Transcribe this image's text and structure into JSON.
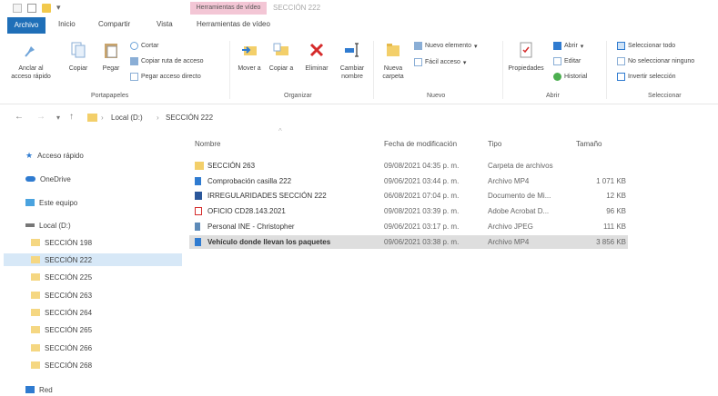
{
  "titlebar": {
    "context_tab": "Herramientas de vídeo",
    "window_title": "SECCIÓN 222"
  },
  "tabs": [
    {
      "label": "Archivo"
    },
    {
      "label": "Inicio"
    },
    {
      "label": "Compartir"
    },
    {
      "label": "Vista"
    },
    {
      "label": "Herramientas de vídeo"
    }
  ],
  "ribbon": {
    "anclar": "Anclar al acceso rápido",
    "copiar": "Copiar",
    "pegar": "Pegar",
    "cortar": "Cortar",
    "copiar_ruta": "Copiar ruta de acceso",
    "pegar_acceso": "Pegar acceso directo",
    "mover": "Mover a",
    "copiar_a": "Copiar a",
    "eliminar": "Eliminar",
    "cambiar": "Cambiar nombre",
    "nueva_carpeta": "Nueva carpeta",
    "nuevo_elemento": "Nuevo elemento",
    "facil_acceso": "Fácil acceso",
    "propiedades": "Propiedades",
    "abrir": "Abrir",
    "editar": "Editar",
    "historial": "Historial",
    "sel_todo": "Seleccionar todo",
    "no_sel": "No seleccionar ninguno",
    "invertir": "Invertir selección",
    "groups": {
      "portapapeles": "Portapapeles",
      "organizar": "Organizar",
      "nuevo": "Nuevo",
      "abrir": "Abrir",
      "seleccionar": "Seleccionar"
    }
  },
  "address": {
    "crumb1": "Local (D:)",
    "crumb2": "SECCIÓN 222"
  },
  "nav": {
    "acceso_rapido": "Acceso rápido",
    "onedrive": "OneDrive",
    "este_equipo": "Este equipo",
    "local": "Local (D:)",
    "folders": [
      "SECCIÓN 198",
      "SECCIÓN 222",
      "SECCIÓN 225",
      "SECCIÓN 263",
      "SECCIÓN 264",
      "SECCIÓN 265",
      "SECCIÓN 266",
      "SECCIÓN 268"
    ],
    "red": "Red"
  },
  "columns": {
    "nombre": "Nombre",
    "fecha": "Fecha de modificación",
    "tipo": "Tipo",
    "tamano": "Tamaño"
  },
  "files": [
    {
      "name": "SECCIÓN 263",
      "date": "09/08/2021 04:35 p. m.",
      "type": "Carpeta de archivos",
      "size": "",
      "icon": "folder"
    },
    {
      "name": "Comprobación casilla 222",
      "date": "09/06/2021 03:44 p. m.",
      "type": "Archivo MP4",
      "size": "1 071 KB",
      "icon": "video"
    },
    {
      "name": "IRREGULARIDADES SECCIÓN 222",
      "date": "06/08/2021 07:04 p. m.",
      "type": "Documento de Mi...",
      "size": "12 KB",
      "icon": "word"
    },
    {
      "name": "OFICIO CD28.143.2021",
      "date": "09/08/2021 03:39 p. m.",
      "type": "Adobe Acrobat D...",
      "size": "96 KB",
      "icon": "pdf"
    },
    {
      "name": "Personal INE - Christopher",
      "date": "09/06/2021 03:17 p. m.",
      "type": "Archivo JPEG",
      "size": "111 KB",
      "icon": "jpeg"
    },
    {
      "name": "Vehículo donde llevan los paquetes",
      "date": "09/06/2021 03:38 p. m.",
      "type": "Archivo MP4",
      "size": "3 856 KB",
      "icon": "video"
    }
  ],
  "colors": {
    "accent": "#1f6fb8",
    "folder": "#f3cf6a",
    "selection": "#d7e8f7"
  }
}
